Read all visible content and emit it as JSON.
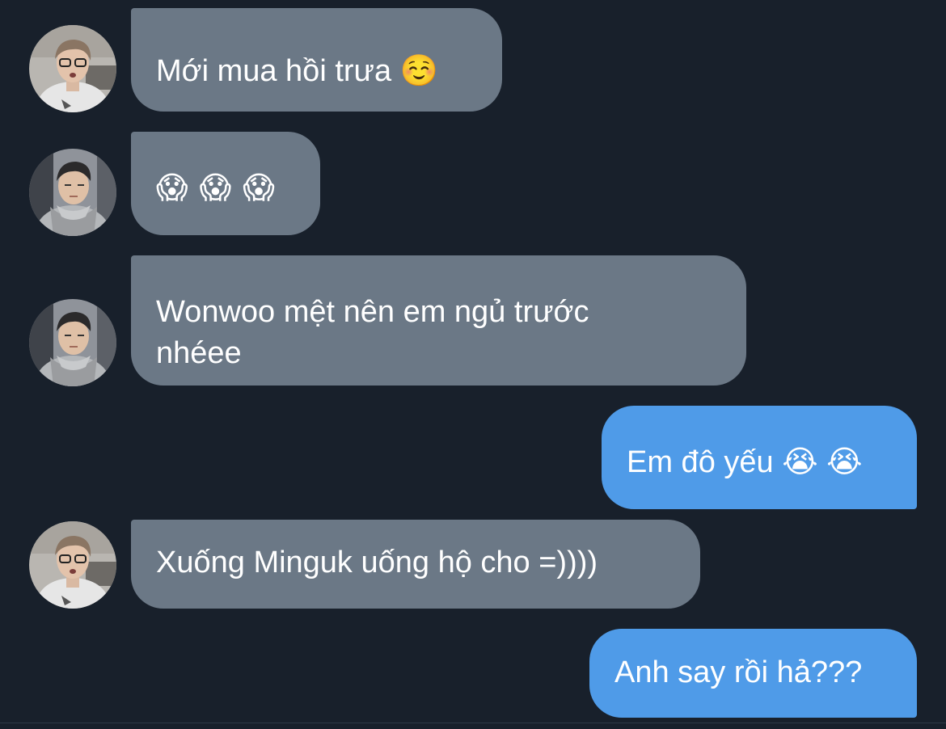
{
  "conversation": {
    "messages": [
      {
        "sender": "contact-a",
        "text": "Mới mua hồi trưa ☺️"
      },
      {
        "sender": "contact-b",
        "text": "😱😱😱"
      },
      {
        "sender": "contact-b",
        "text": "Wonwoo mệt nên em ngủ trước\nnhéee"
      },
      {
        "sender": "me",
        "text": "Em đô yếu 😭 😭"
      },
      {
        "sender": "contact-a",
        "text": "Xuống Minguk uống hộ cho =))))"
      },
      {
        "sender": "me",
        "text": "Anh say rồi hả???"
      }
    ]
  },
  "colors": {
    "background": "#18202b",
    "incoming_bubble": "#6b7886",
    "outgoing_bubble": "#4f9be8",
    "text": "#ffffff"
  },
  "icons": {
    "avatar_a": "avatar-glasses-person-icon",
    "avatar_b": "avatar-scarf-person-icon"
  }
}
